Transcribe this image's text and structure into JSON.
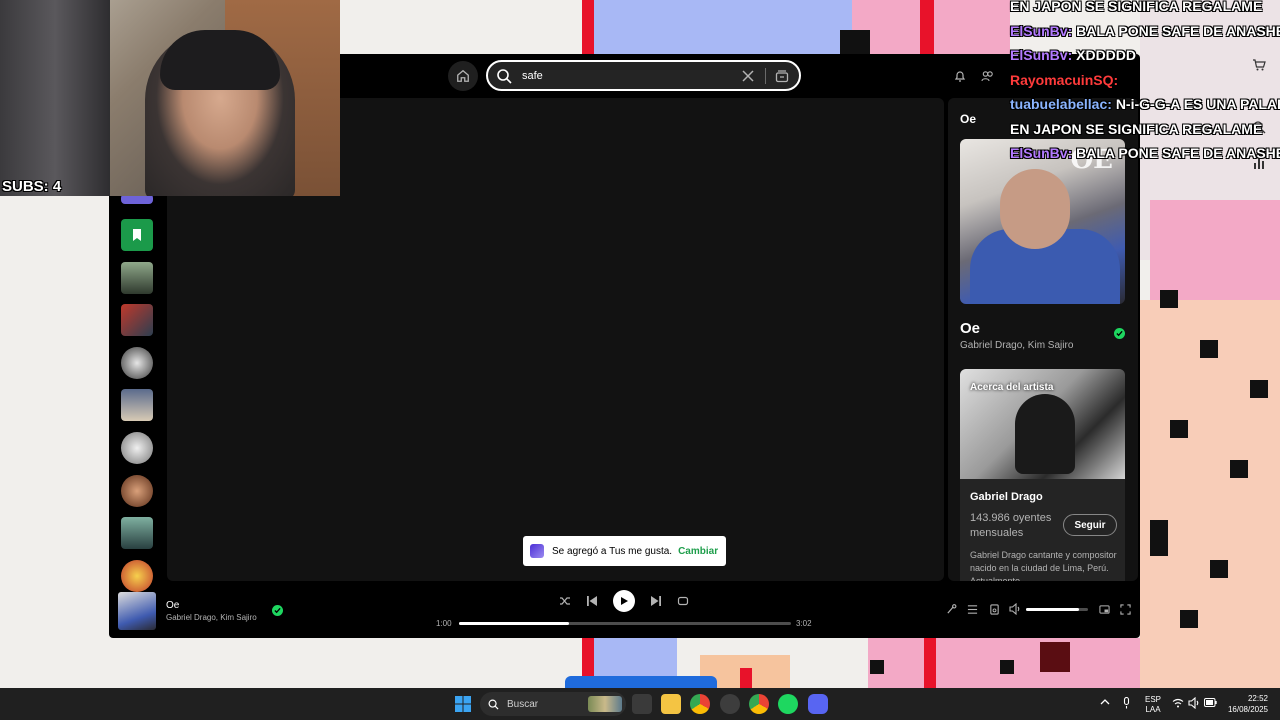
{
  "webcam": {
    "subs_text": "SUBS: 4"
  },
  "chat": [
    {
      "user": "",
      "message": "EN JAPON SE SIGNIFICA REGALAME",
      "user_color": ""
    },
    {
      "user": "ElSunBv:",
      "message": "BALA PONE SAFE DE ANASHE",
      "user_color": "purple"
    },
    {
      "user": "ElSunBv:",
      "message": "XDDDDD",
      "user_color": "purple"
    },
    {
      "user": "RayomacuinSQ:",
      "message": "",
      "user_color": "red"
    },
    {
      "user": "tuabuelabellac:",
      "message": "N-i-G-G-A ES UNA PALAB",
      "user_color": "blue"
    },
    {
      "user": "",
      "message": "EN JAPON SE SIGNIFICA REGALAME",
      "user_color": ""
    },
    {
      "user": "ElSunBv:",
      "message": "BALA PONE SAFE DE ANASHE",
      "user_color": "purple"
    }
  ],
  "spotify": {
    "search": {
      "value": "safe",
      "placeholder": ""
    },
    "now_playing_view": {
      "title": "Oe",
      "song_name": "Oe",
      "artists": "Gabriel Drago, Kim Sajiro",
      "cover_logo": "OE",
      "about_label": "Acerca del artista",
      "artist_name": "Gabriel Drago",
      "listeners": "143.986 oyentes mensuales",
      "follow_label": "Seguir",
      "bio": "Gabriel Drago cantante y compositor nacido en la ciudad de Lima, Perú. Actualmente"
    },
    "toast": {
      "message": "Se agregó a Tus me gusta.",
      "action": "Cambiar"
    },
    "player": {
      "title": "Oe",
      "artists": "Gabriel Drago, Kim Sajiro",
      "elapsed": "1:00",
      "duration": "3:02",
      "progress_fraction": 0.33,
      "volume_fraction": 0.85
    }
  },
  "taskbar": {
    "search_label": "Buscar",
    "lang_top": "ESP",
    "lang_bottom": "LAA",
    "time": "22:52",
    "date": "16/08/2025"
  },
  "colors": {
    "accent_green": "#1ed760",
    "chat_purple": "#b37bff",
    "chat_blue": "#8ab4ff"
  }
}
